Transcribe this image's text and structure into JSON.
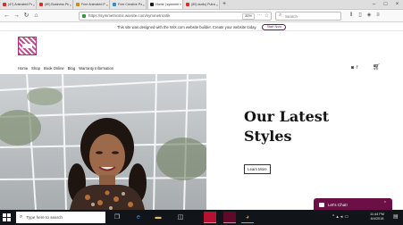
{
  "browser": {
    "tabs": [
      {
        "label": "(47) Animated PowerPoi",
        "favicon_color": "#e02a24",
        "active": false
      },
      {
        "label": "(80) Business Plan Prese",
        "favicon_color": "#e02a24",
        "active": false
      },
      {
        "label": "Free Animated PowerPo",
        "favicon_color": "#d08a1a",
        "active": false
      },
      {
        "label": "Free Creative PowerPoin",
        "favicon_color": "#2b8fd8",
        "active": false
      },
      {
        "label": "Home | symmetricstat",
        "favicon_color": "#1a1a1a",
        "active": true
      },
      {
        "label": "(80) dudlu| Putra Putri F",
        "favicon_color": "#e02a24",
        "active": false
      }
    ],
    "new_tab_icon": "plus-icon",
    "url": "https://symmetricstic.wixsite.com/symmetricstik",
    "zoom": "80%",
    "search_placeholder": "Search",
    "nav_icons": [
      "back-arrow-icon",
      "forward-arrow-icon",
      "reload-icon",
      "home-icon"
    ],
    "tool_icons": [
      "library-icon",
      "sidebar-icon",
      "shield-icon",
      "menu-icon"
    ]
  },
  "wix_banner": {
    "text": "This site was designed with the WiX.com website builder. Create your website today.",
    "button": "Start Now"
  },
  "site": {
    "nav": [
      "Home",
      "Shop",
      "Book Online",
      "Blog",
      "Warranty Information"
    ],
    "social_icons": [
      "instagram-icon",
      "facebook-icon"
    ],
    "cart_icon": "cart-icon",
    "hero_title_line1": "Our Latest",
    "hero_title_line2": "Styles",
    "learn_more": "Learn More",
    "chat_label": "Let's Chat!"
  },
  "taskbar": {
    "search_placeholder": "Type here to search",
    "time": "11:44 PM",
    "date": "6/4/2018",
    "apps": [
      "task-view-icon",
      "edge-icon",
      "file-explorer-icon",
      "store-icon",
      "app-red-icon",
      "app-dark-red-icon",
      "firefox-icon"
    ]
  },
  "colors": {
    "brand": "#6b0f46",
    "accent_pink": "#c24b8b",
    "taskbar": "#111418"
  }
}
